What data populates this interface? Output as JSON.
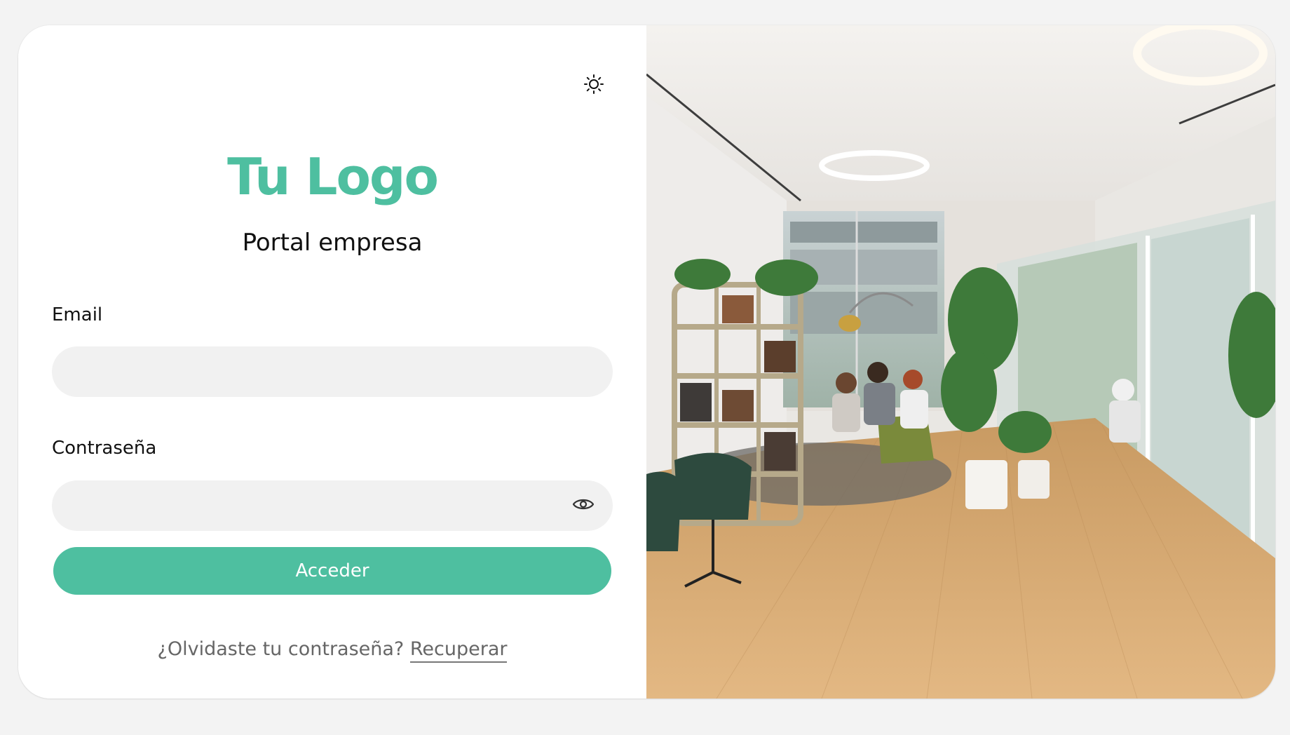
{
  "brand": {
    "logo_text": "Tu Logo",
    "subtitle": "Portal empresa",
    "accent_color": "#4ebfa0"
  },
  "header": {
    "theme_toggle_icon": "sun-icon"
  },
  "form": {
    "email_label": "Email",
    "email_value": "",
    "password_label": "Contraseña",
    "password_value": "",
    "password_visibility_icon": "eye-icon",
    "submit_label": "Acceder"
  },
  "footer": {
    "forgot_prompt": "¿Olvidaste tu contraseña?",
    "recover_link": "Recuperar"
  },
  "side_image": {
    "subject": "office-lounge-photo"
  }
}
